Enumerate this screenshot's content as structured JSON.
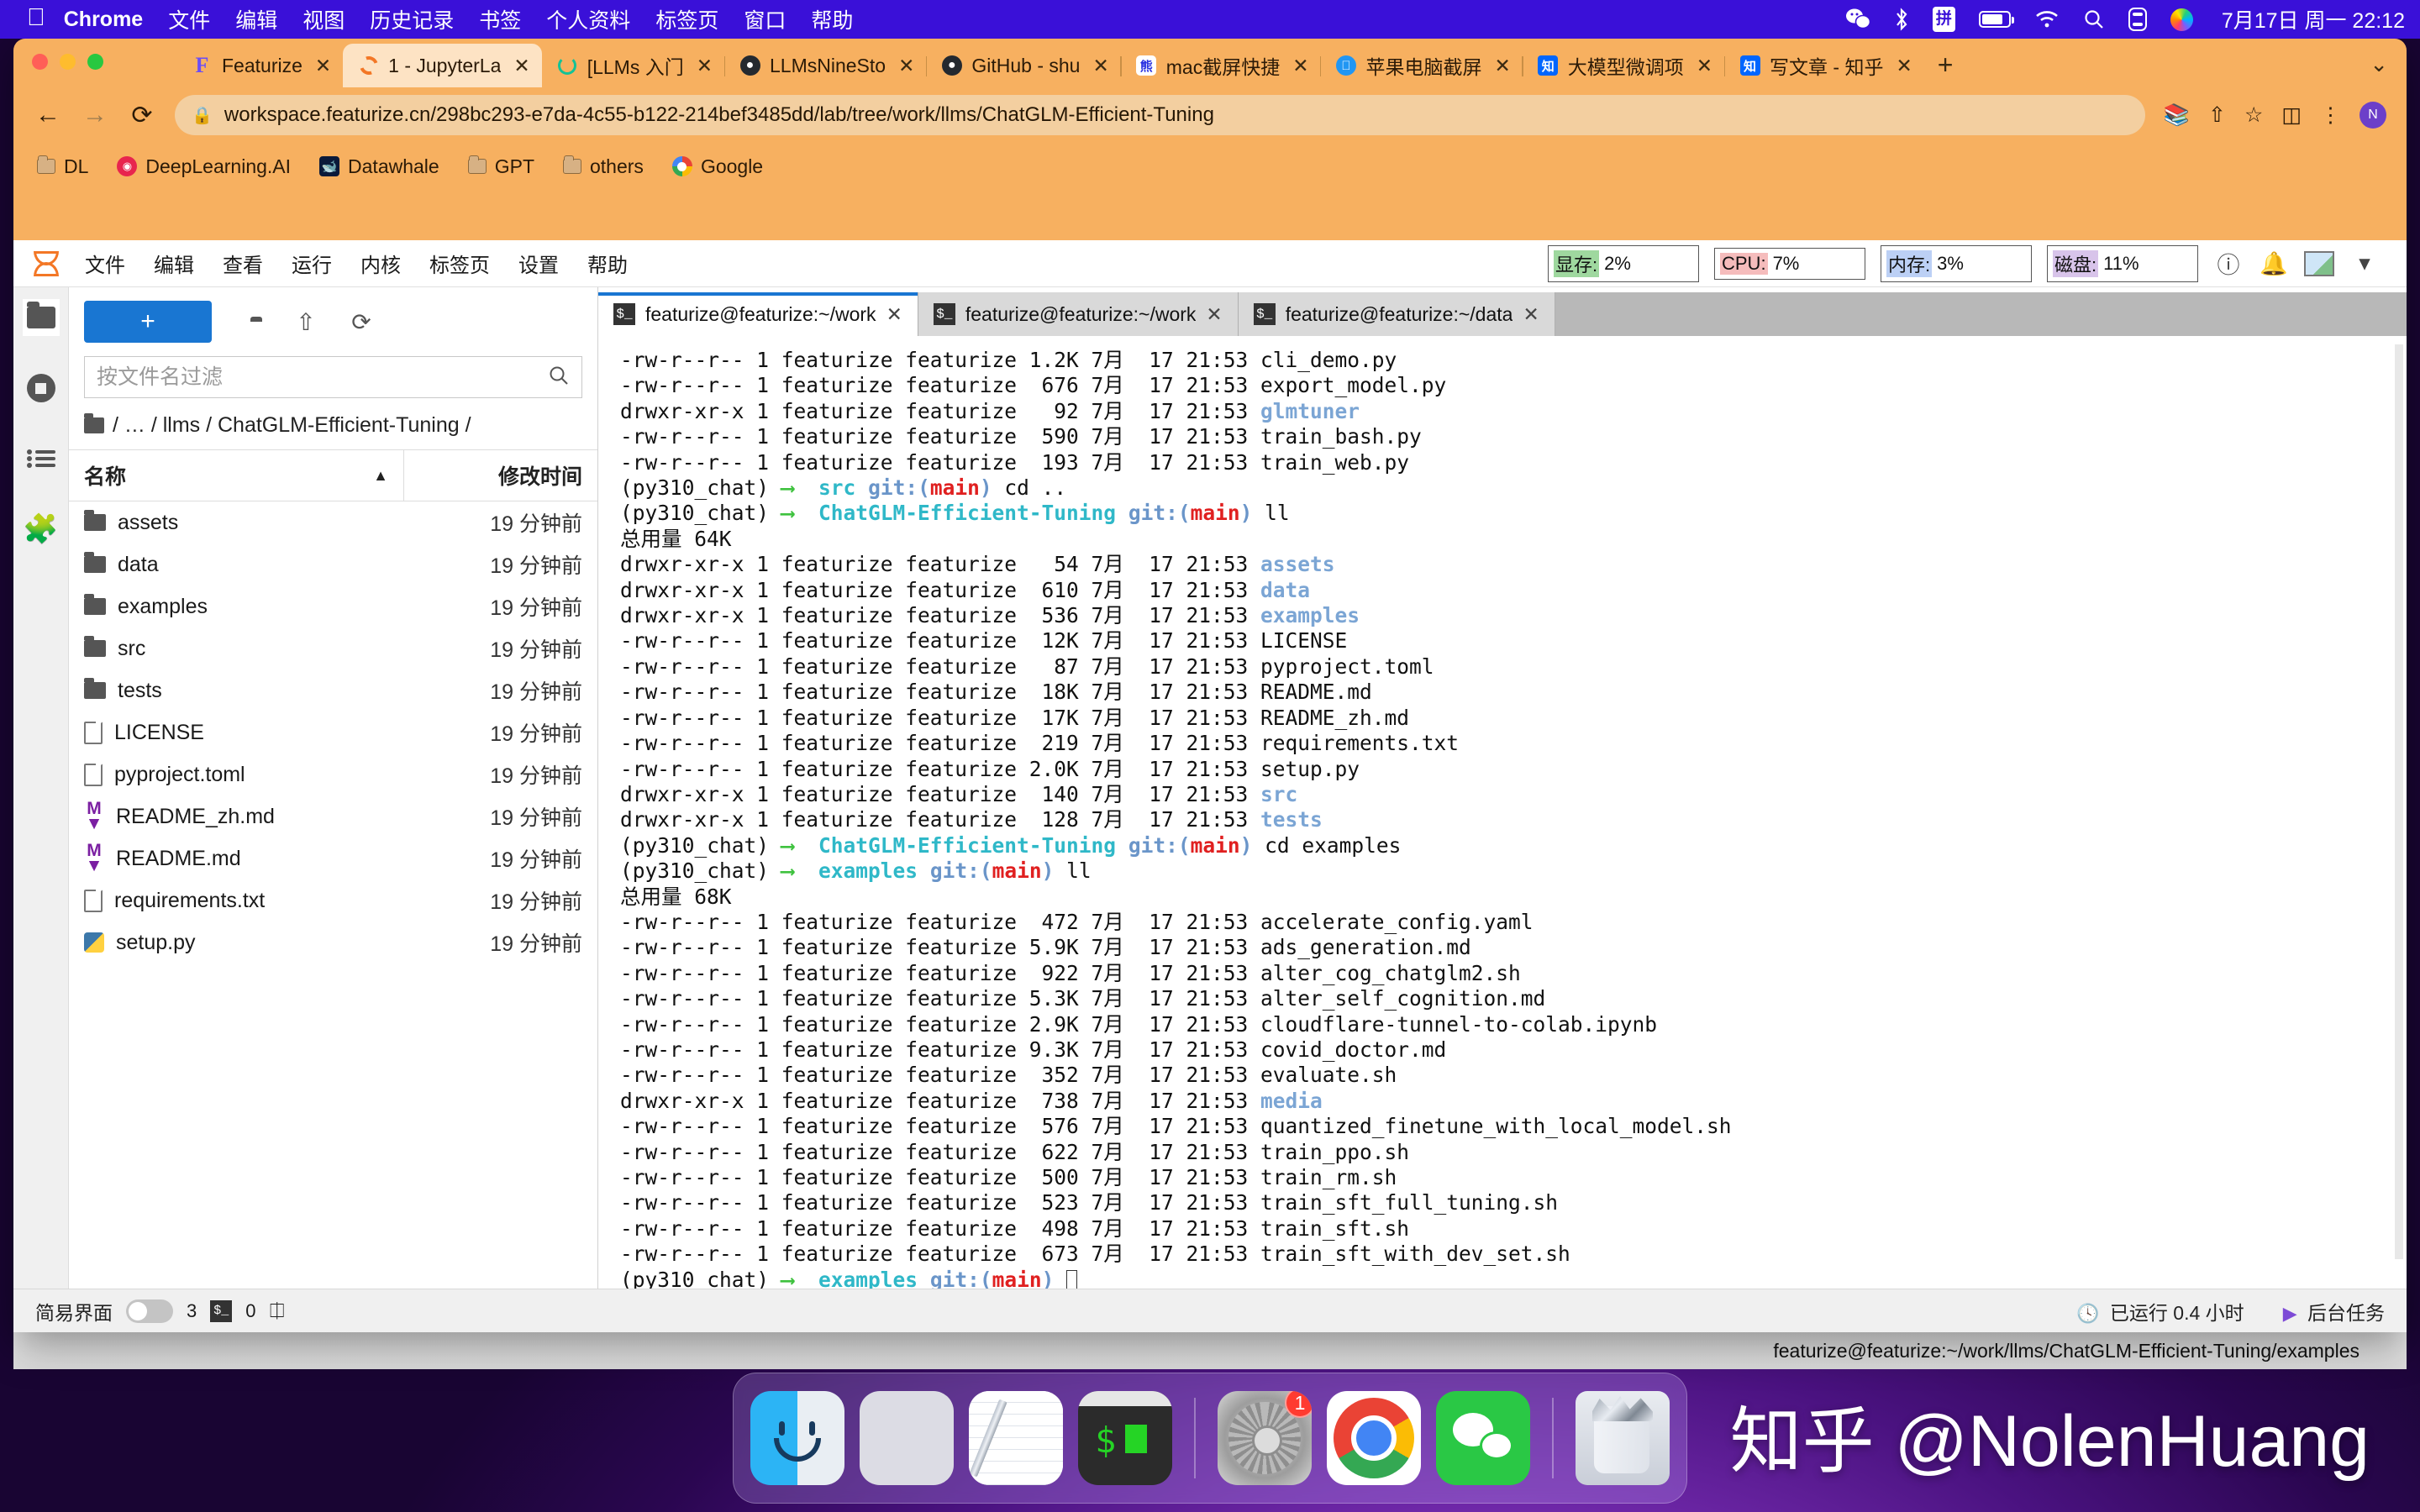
{
  "macos_menubar": {
    "apple_icon": "apple-icon",
    "items": [
      "Chrome",
      "文件",
      "编辑",
      "视图",
      "历史记录",
      "书签",
      "个人资料",
      "标签页",
      "窗口",
      "帮助"
    ],
    "status_icons": [
      "wechat-icon",
      "bluetooth-icon",
      "input-method-icon",
      "battery-icon",
      "wifi-icon",
      "search-icon",
      "control-center-icon",
      "siri-icon"
    ],
    "input_method_label": "拼",
    "datetime": "7月17日 周一  22:12"
  },
  "browser": {
    "tabs": [
      {
        "title": "Featurize",
        "favicon": "featurize-icon",
        "active": false
      },
      {
        "title": "1 - JupyterLa",
        "favicon": "jupyter-icon",
        "active": true
      },
      {
        "title": "[LLMs 入门",
        "favicon": "llms-icon",
        "active": false
      },
      {
        "title": "LLMsNineSto",
        "favicon": "github-icon",
        "active": false
      },
      {
        "title": "GitHub - shu",
        "favicon": "github-icon",
        "active": false
      },
      {
        "title": "mac截屏快捷",
        "favicon": "baidu-icon",
        "active": false
      },
      {
        "title": "苹果电脑截屏",
        "favicon": "apple-support-icon",
        "active": false
      },
      {
        "title": "大模型微调项",
        "favicon": "zhihu-icon",
        "active": false
      },
      {
        "title": "写文章 - 知乎",
        "favicon": "zhihu-icon",
        "active": false
      }
    ],
    "new_tab_label": "+",
    "window_controls_label": "⌄",
    "nav": {
      "back": "←",
      "forward": "→",
      "reload": "⟳"
    },
    "url": "workspace.featurize.cn/298bc293-e7da-4c55-b122-214bef3485dd/lab/tree/work/llms/ChatGLM-Efficient-Tuning",
    "lock_icon": "lock-icon",
    "omni_right_icons": [
      "translate-icon",
      "share-icon",
      "bookmark-star-icon",
      "sidepanel-icon",
      "extensions-icon"
    ],
    "avatar_label": "N",
    "bookmarks": [
      {
        "label": "DL",
        "icon": "folder-icon"
      },
      {
        "label": "DeepLearning.AI",
        "icon": "deeplearning-icon"
      },
      {
        "label": "Datawhale",
        "icon": "datawhale-icon"
      },
      {
        "label": "GPT",
        "icon": "folder-icon"
      },
      {
        "label": "others",
        "icon": "folder-icon"
      },
      {
        "label": "Google",
        "icon": "google-icon"
      }
    ]
  },
  "jupyter": {
    "menu": [
      "文件",
      "编辑",
      "查看",
      "运行",
      "内核",
      "标签页",
      "设置",
      "帮助"
    ],
    "resource_stats": [
      {
        "label": "显存:",
        "value": "2%",
        "tag_color": "#9fd89f"
      },
      {
        "label": "CPU:",
        "value": "7%",
        "tag_color": "#f5bcbc"
      },
      {
        "label": "内存:",
        "value": "3%",
        "tag_color": "#bcd0f5"
      },
      {
        "label": "磁盘:",
        "value": "11%",
        "tag_color": "#d8c4ea"
      }
    ],
    "header_icons": [
      "help-icon",
      "notification-bell-icon",
      "kernel-thumbnail-icon",
      "chevron-down-icon"
    ],
    "rail_icons": [
      "folder-icon",
      "running-terminals-icon",
      "table-of-contents-icon",
      "extensions-puzzle-icon"
    ],
    "file_browser": {
      "new_button_label": "+",
      "toolbar_icons": [
        "new-folder-icon",
        "upload-icon",
        "refresh-icon"
      ],
      "filter_placeholder": "按文件名过滤",
      "search_icon": "search-icon",
      "breadcrumb": "/ … / llms / ChatGLM-Efficient-Tuning /",
      "columns": [
        "名称",
        "修改时间"
      ],
      "sort_indicator": "▲",
      "items": [
        {
          "name": "assets",
          "modified": "19 分钟前",
          "type": "folder"
        },
        {
          "name": "data",
          "modified": "19 分钟前",
          "type": "folder"
        },
        {
          "name": "examples",
          "modified": "19 分钟前",
          "type": "folder"
        },
        {
          "name": "src",
          "modified": "19 分钟前",
          "type": "folder"
        },
        {
          "name": "tests",
          "modified": "19 分钟前",
          "type": "folder"
        },
        {
          "name": "LICENSE",
          "modified": "19 分钟前",
          "type": "file"
        },
        {
          "name": "pyproject.toml",
          "modified": "19 分钟前",
          "type": "file"
        },
        {
          "name": "README_zh.md",
          "modified": "19 分钟前",
          "type": "markdown"
        },
        {
          "name": "README.md",
          "modified": "19 分钟前",
          "type": "markdown"
        },
        {
          "name": "requirements.txt",
          "modified": "19 分钟前",
          "type": "file"
        },
        {
          "name": "setup.py",
          "modified": "19 分钟前",
          "type": "python"
        }
      ]
    },
    "terminal_tabs": [
      {
        "label": "featurize@featurize:~/work",
        "active": true
      },
      {
        "label": "featurize@featurize:~/work",
        "active": false
      },
      {
        "label": "featurize@featurize:~/data",
        "active": false
      }
    ],
    "terminal_lines": [
      {
        "plain": "-rw-r--r-- 1 featurize featurize 1.2K 7月  17 21:53 cli_demo.py"
      },
      {
        "plain": "-rw-r--r-- 1 featurize featurize  676 7月  17 21:53 export_model.py"
      },
      {
        "pre": "drwxr-xr-x 1 featurize featurize   92 7月  17 21:53 ",
        "dir": "glmtuner"
      },
      {
        "plain": "-rw-r--r-- 1 featurize featurize  590 7月  17 21:53 train_bash.py"
      },
      {
        "plain": "-rw-r--r-- 1 featurize featurize  193 7月  17 21:53 train_web.py"
      },
      {
        "prompt": {
          "env": "(py310_chat)",
          "dir": "src",
          "cmd": "cd .."
        }
      },
      {
        "prompt": {
          "env": "(py310_chat)",
          "dir": "ChatGLM-Efficient-Tuning",
          "cmd": "ll"
        }
      },
      {
        "plain": "总用量 64K"
      },
      {
        "pre": "drwxr-xr-x 1 featurize featurize   54 7月  17 21:53 ",
        "dir": "assets"
      },
      {
        "pre": "drwxr-xr-x 1 featurize featurize  610 7月  17 21:53 ",
        "dir": "data"
      },
      {
        "pre": "drwxr-xr-x 1 featurize featurize  536 7月  17 21:53 ",
        "dir": "examples"
      },
      {
        "plain": "-rw-r--r-- 1 featurize featurize  12K 7月  17 21:53 LICENSE"
      },
      {
        "plain": "-rw-r--r-- 1 featurize featurize   87 7月  17 21:53 pyproject.toml"
      },
      {
        "plain": "-rw-r--r-- 1 featurize featurize  18K 7月  17 21:53 README.md"
      },
      {
        "plain": "-rw-r--r-- 1 featurize featurize  17K 7月  17 21:53 README_zh.md"
      },
      {
        "plain": "-rw-r--r-- 1 featurize featurize  219 7月  17 21:53 requirements.txt"
      },
      {
        "plain": "-rw-r--r-- 1 featurize featurize 2.0K 7月  17 21:53 setup.py"
      },
      {
        "pre": "drwxr-xr-x 1 featurize featurize  140 7月  17 21:53 ",
        "dir": "src"
      },
      {
        "pre": "drwxr-xr-x 1 featurize featurize  128 7月  17 21:53 ",
        "dir": "tests"
      },
      {
        "prompt": {
          "env": "(py310_chat)",
          "dir": "ChatGLM-Efficient-Tuning",
          "cmd": "cd examples"
        }
      },
      {
        "prompt": {
          "env": "(py310_chat)",
          "dir": "examples",
          "cmd": "ll"
        }
      },
      {
        "plain": "总用量 68K"
      },
      {
        "plain": "-rw-r--r-- 1 featurize featurize  472 7月  17 21:53 accelerate_config.yaml"
      },
      {
        "plain": "-rw-r--r-- 1 featurize featurize 5.9K 7月  17 21:53 ads_generation.md"
      },
      {
        "plain": "-rw-r--r-- 1 featurize featurize  922 7月  17 21:53 alter_cog_chatglm2.sh"
      },
      {
        "plain": "-rw-r--r-- 1 featurize featurize 5.3K 7月  17 21:53 alter_self_cognition.md"
      },
      {
        "plain": "-rw-r--r-- 1 featurize featurize 2.9K 7月  17 21:53 cloudflare-tunnel-to-colab.ipynb"
      },
      {
        "plain": "-rw-r--r-- 1 featurize featurize 9.3K 7月  17 21:53 covid_doctor.md"
      },
      {
        "plain": "-rw-r--r-- 1 featurize featurize  352 7月  17 21:53 evaluate.sh"
      },
      {
        "pre": "drwxr-xr-x 1 featurize featurize  738 7月  17 21:53 ",
        "dir": "media"
      },
      {
        "plain": "-rw-r--r-- 1 featurize featurize  576 7月  17 21:53 quantized_finetune_with_local_model.sh"
      },
      {
        "plain": "-rw-r--r-- 1 featurize featurize  622 7月  17 21:53 train_ppo.sh"
      },
      {
        "plain": "-rw-r--r-- 1 featurize featurize  500 7月  17 21:53 train_rm.sh"
      },
      {
        "plain": "-rw-r--r-- 1 featurize featurize  523 7月  17 21:53 train_sft_full_tuning.sh"
      },
      {
        "plain": "-rw-r--r-- 1 featurize featurize  498 7月  17 21:53 train_sft.sh"
      },
      {
        "plain": "-rw-r--r-- 1 featurize featurize  673 7月  17 21:53 train_sft_with_dev_set.sh"
      },
      {
        "prompt": {
          "env": "(py310_chat)",
          "dir": "examples",
          "cmd": "",
          "cursor": true
        }
      }
    ],
    "status_bar": {
      "simple_ui_label": "简易界面",
      "terminal_count": "3",
      "kernel_count": "0",
      "kernel_icon": "cpu-icon",
      "uptime": "已运行 0.4 小时",
      "uptime_icon": "clock-icon",
      "background_tasks": "后台任务",
      "background_icon": "tasks-icon"
    }
  },
  "host_status_bar": {
    "path": "featurize@featurize:~/work/llms/ChatGLM-Efficient-Tuning/examples"
  },
  "dock": {
    "apps": [
      {
        "name": "finder",
        "running": true
      },
      {
        "name": "launchpad",
        "running": false
      },
      {
        "name": "notes",
        "running": false
      },
      {
        "name": "terminal",
        "running": false
      },
      {
        "name": "system-settings",
        "running": true,
        "badge": "1"
      },
      {
        "name": "chrome",
        "running": true
      },
      {
        "name": "wechat",
        "running": false
      },
      {
        "name": "trash",
        "running": false
      }
    ]
  },
  "watermark": "知乎 @NolenHuang",
  "colors": {
    "menubar_bg": "#3a10d8",
    "chrome_bg": "#f7b060",
    "chrome_active_tab": "#fde3c4",
    "accent_blue": "#1976d2",
    "terminal_cyan": "#2fb8c8",
    "terminal_red": "#e02020",
    "terminal_green": "#3fc23f",
    "dir_blue": "#7ba5d4"
  }
}
